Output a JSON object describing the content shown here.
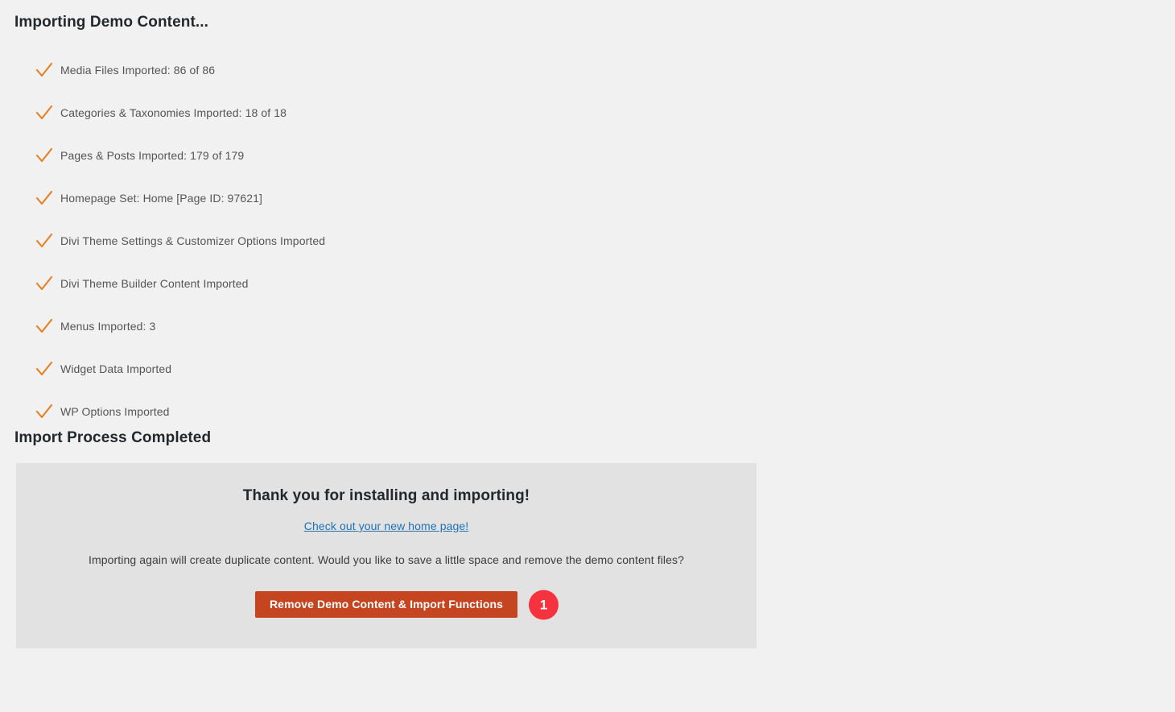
{
  "page": {
    "title": "Importing Demo Content...",
    "completed_title": "Import Process Completed",
    "background_color": "#f1f1f1"
  },
  "progress": {
    "check_icon": "check-icon",
    "check_color": "#e58020",
    "items": [
      {
        "label": "Media Files Imported: 86 of 86"
      },
      {
        "label": "Categories & Taxonomies Imported: 18 of 18"
      },
      {
        "label": "Pages & Posts Imported: 179 of 179"
      },
      {
        "label": "Homepage Set: Home [Page ID: 97621]"
      },
      {
        "label": "Divi Theme Settings & Customizer Options Imported"
      },
      {
        "label": "Divi Theme Builder Content Imported"
      },
      {
        "label": "Menus Imported: 3"
      },
      {
        "label": "Widget Data Imported"
      },
      {
        "label": "WP Options Imported"
      }
    ]
  },
  "completion_panel": {
    "background_color": "#e2e2e2",
    "heading": "Thank you for installing and importing!",
    "home_link": "Check out your new home page!",
    "link_color": "#2271b1",
    "paragraph": "Importing again will create duplicate content. Would you like to save a little space and remove the demo content files?",
    "remove_button": {
      "label": "Remove Demo Content & Import Functions",
      "color": "#c4451f"
    },
    "step_badge": {
      "number": "1",
      "color": "#f5333f"
    }
  }
}
